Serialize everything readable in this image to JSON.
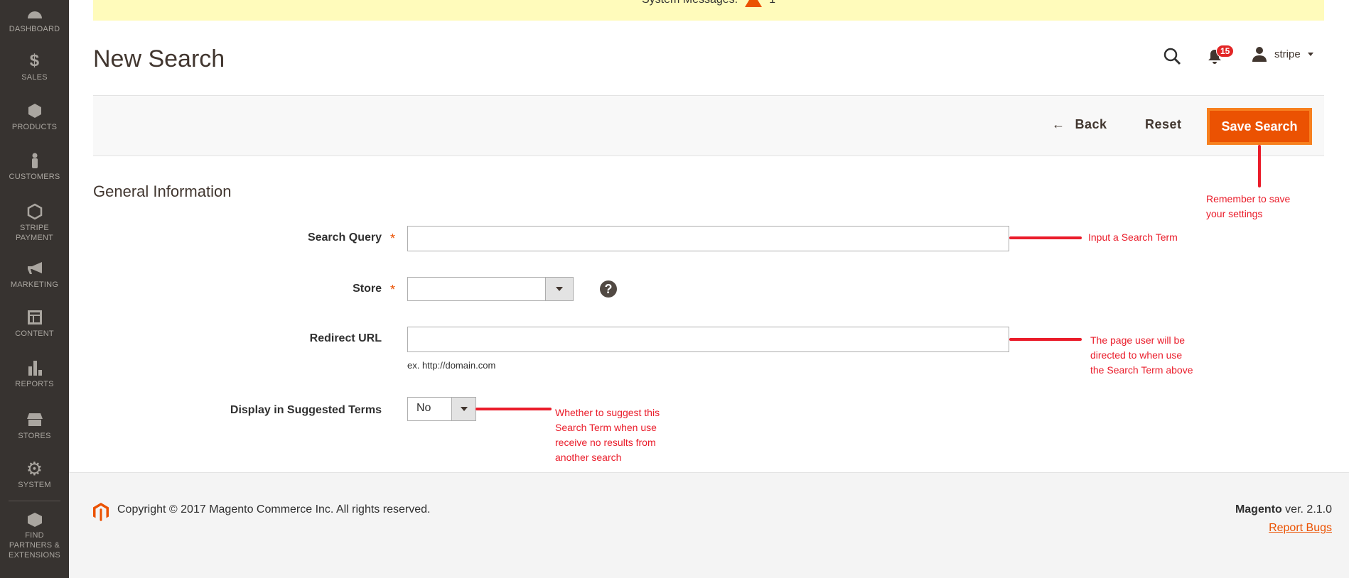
{
  "sidebar": {
    "items": [
      {
        "label": "DASHBOARD",
        "icon": "dashboard-icon"
      },
      {
        "label": "SALES",
        "icon": "dollar-icon"
      },
      {
        "label": "PRODUCTS",
        "icon": "box-icon"
      },
      {
        "label": "CUSTOMERS",
        "icon": "person-icon"
      },
      {
        "label": "STRIPE PAYMENT",
        "icon": "hexagon-icon"
      },
      {
        "label": "MARKETING",
        "icon": "megaphone-icon"
      },
      {
        "label": "CONTENT",
        "icon": "layout-icon"
      },
      {
        "label": "REPORTS",
        "icon": "bar-chart-icon"
      },
      {
        "label": "STORES",
        "icon": "storefront-icon"
      },
      {
        "label": "SYSTEM",
        "icon": "gear-icon"
      },
      {
        "label": "FIND PARTNERS & EXTENSIONS",
        "icon": "lego-brick-icon"
      }
    ]
  },
  "banner": {
    "text": "System Messages:",
    "count": "1",
    "color": "#fffbbb"
  },
  "header": {
    "title": "New Search",
    "notifications": "15",
    "user": "stripe"
  },
  "actions": {
    "back": "Back",
    "reset": "Reset",
    "save": "Save Search",
    "save_color": "#eb5202"
  },
  "form": {
    "section": "General Information",
    "fields": [
      {
        "label": "Search Query",
        "required": true,
        "value": ""
      },
      {
        "label": "Store",
        "required": true,
        "value": ""
      },
      {
        "label": "Redirect URL",
        "required": false,
        "value": "",
        "note": "ex. http://domain.com"
      },
      {
        "label": "Display in Suggested Terms",
        "required": false,
        "value": "No"
      }
    ],
    "required_mark": "*"
  },
  "annotations": {
    "save": [
      "Remember to save",
      "your settings"
    ],
    "query": [
      "Input a Search Term"
    ],
    "redirect": [
      "The page user will be",
      "directed to when use",
      "the Search Term above"
    ],
    "display": [
      "Whether to suggest this",
      "Search Term when use",
      "receive no results from",
      "another search"
    ],
    "color": "#ea1c2a"
  },
  "footer": {
    "copyright": "Copyright © 2017 Magento Commerce Inc. All rights reserved.",
    "brand": "Magento",
    "version": " ver. 2.1.0",
    "report": "Report Bugs"
  }
}
